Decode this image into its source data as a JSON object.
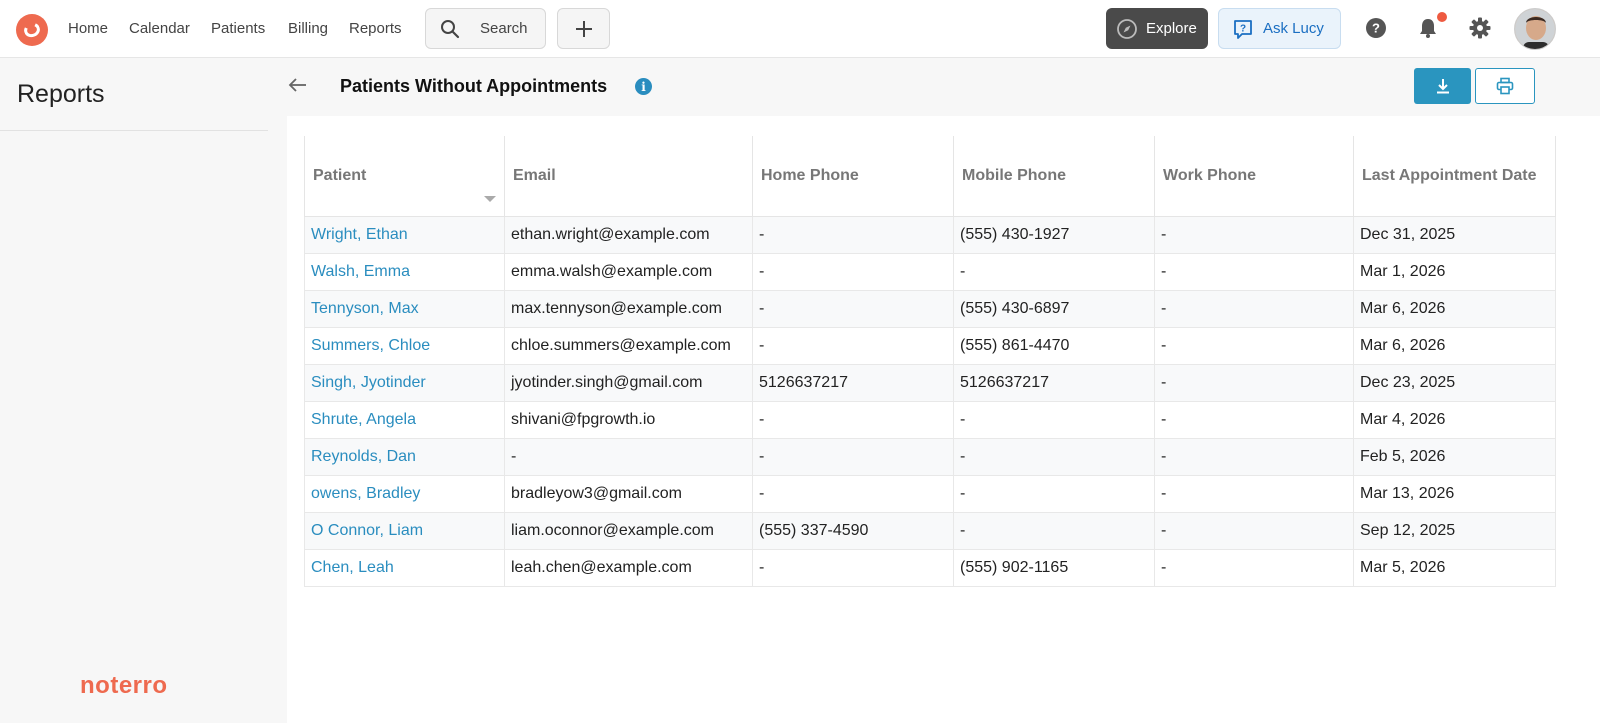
{
  "nav": {
    "items": [
      {
        "label": "Home"
      },
      {
        "label": "Calendar"
      },
      {
        "label": "Patients"
      },
      {
        "label": "Billing"
      },
      {
        "label": "Reports"
      }
    ],
    "search_label": "Search",
    "explore_label": "Explore",
    "ask_lucy_label": "Ask Lucy"
  },
  "sidebar": {
    "title": "Reports",
    "brand": "noterro"
  },
  "report": {
    "title": "Patients Without Appointments"
  },
  "table": {
    "headers": [
      "Patient",
      "Email",
      "Home Phone",
      "Mobile Phone",
      "Work Phone",
      "Last Appointment Date"
    ],
    "rows": [
      [
        "Wright, Ethan",
        "ethan.wright@example.com",
        "-",
        "(555) 430-1927",
        "-",
        "Dec 31, 2025"
      ],
      [
        "Walsh, Emma",
        "emma.walsh@example.com",
        "-",
        "-",
        "-",
        "Mar 1, 2026"
      ],
      [
        "Tennyson, Max",
        "max.tennyson@example.com",
        "-",
        "(555) 430-6897",
        "-",
        "Mar 6, 2026"
      ],
      [
        "Summers, Chloe",
        "chloe.summers@example.com",
        "-",
        "(555) 861-4470",
        "-",
        "Mar 6, 2026"
      ],
      [
        "Singh, Jyotinder",
        "jyotinder.singh@gmail.com",
        "5126637217",
        "5126637217",
        "-",
        "Dec 23, 2025"
      ],
      [
        "Shrute, Angela",
        "shivani@fpgrowth.io",
        "-",
        "-",
        "-",
        "Mar 4, 2026"
      ],
      [
        "Reynolds, Dan",
        "-",
        "-",
        "-",
        "-",
        "Feb 5, 2026"
      ],
      [
        "owens, Bradley",
        "bradleyow3@gmail.com",
        "-",
        "-",
        "-",
        "Mar 13, 2026"
      ],
      [
        "O Connor, Liam",
        "liam.oconnor@example.com",
        "(555) 337-4590",
        "-",
        "-",
        "Sep 12, 2025"
      ],
      [
        "Chen, Leah",
        "leah.chen@example.com",
        "-",
        "(555) 902-1165",
        "-",
        "Mar 5, 2026"
      ]
    ]
  },
  "colors": {
    "brand": "#ee6a4f",
    "link": "#2a8dbf",
    "accent": "#2a95bf"
  }
}
